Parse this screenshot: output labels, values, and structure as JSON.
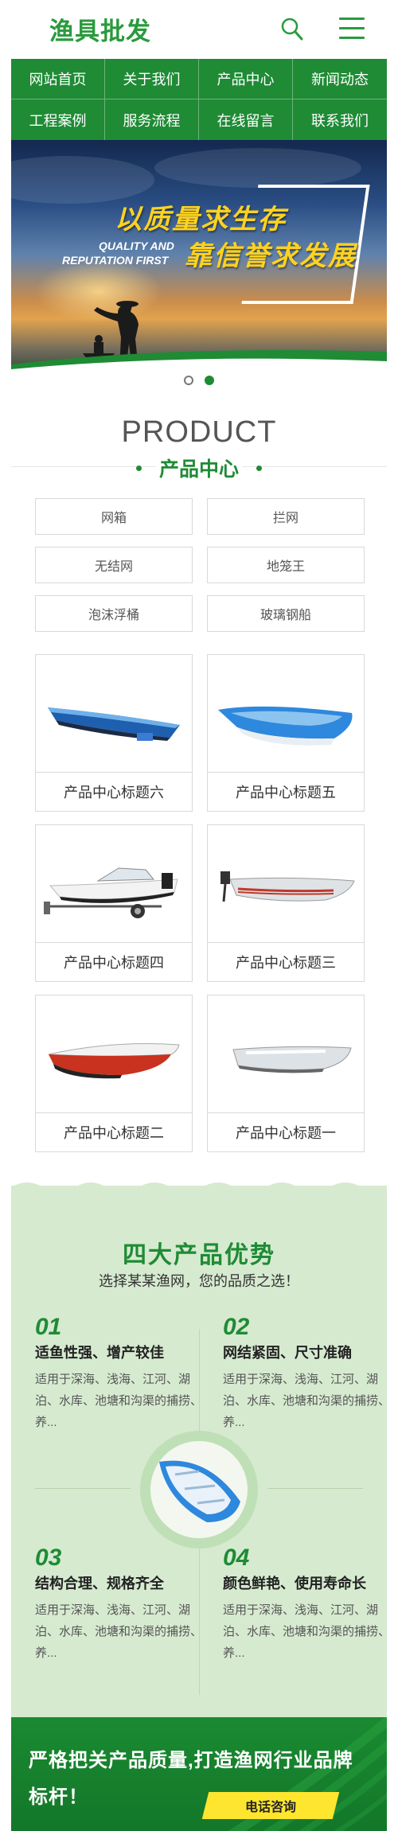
{
  "header": {
    "logo": "渔具批发"
  },
  "nav": {
    "items": [
      {
        "label": "网站首页"
      },
      {
        "label": "关于我们"
      },
      {
        "label": "产品中心"
      },
      {
        "label": "新闻动态"
      },
      {
        "label": "工程案例"
      },
      {
        "label": "服务流程"
      },
      {
        "label": "在线留言"
      },
      {
        "label": "联系我们"
      }
    ]
  },
  "banner": {
    "slogan_cn_line1": "以质量求生存",
    "slogan_en_line1": "QUALITY AND",
    "slogan_en_line2": "REPUTATION FIRST",
    "slogan_cn_line2": "靠信誉求发展",
    "slides": 2,
    "active_slide": 2
  },
  "product": {
    "heading_en": "PRODUCT",
    "heading_cn": "产品中心",
    "categories": [
      "网箱",
      "拦网",
      "无结网",
      "地笼王",
      "泡沫浮桶",
      "玻璃钢船"
    ],
    "items": [
      {
        "title": "产品中心标题六",
        "icon": "boat-blue-fishing-icon"
      },
      {
        "title": "产品中心标题五",
        "icon": "boat-blue-white-icon"
      },
      {
        "title": "产品中心标题四",
        "icon": "speedboat-trailer-icon"
      },
      {
        "title": "产品中心标题三",
        "icon": "boat-grey-motor-icon"
      },
      {
        "title": "产品中心标题二",
        "icon": "boat-red-white-icon"
      },
      {
        "title": "产品中心标题一",
        "icon": "boat-grey-icon"
      }
    ]
  },
  "advantages": {
    "title": "四大产品优势",
    "subtitle": "选择某某渔网，您的品质之选！",
    "items": [
      {
        "num": "01",
        "head": "适鱼性强、增产较佳",
        "desc": "适用于深海、浅海、江河、湖泊、水库、池塘和沟渠的捕捞、养..."
      },
      {
        "num": "02",
        "head": "网结紧固、尺寸准确",
        "desc": "适用于深海、浅海、江河、湖泊、水库、池塘和沟渠的捕捞、养..."
      },
      {
        "num": "03",
        "head": "结构合理、规格齐全",
        "desc": "适用于深海、浅海、江河、湖泊、水库、池塘和沟渠的捕捞、养..."
      },
      {
        "num": "04",
        "head": "颜色鲜艳、使用寿命长",
        "desc": "适用于深海、浅海、江河、湖泊、水库、池塘和沟渠的捕捞、养..."
      }
    ]
  },
  "footer_banner": {
    "text": "严格把关产品质量,打造渔网行业品牌标杆！",
    "button": "电话咨询"
  },
  "colors": {
    "brand_green": "#1f8b35",
    "accent_yellow": "#ffe62e",
    "advantage_bg": "#d6ead0"
  }
}
